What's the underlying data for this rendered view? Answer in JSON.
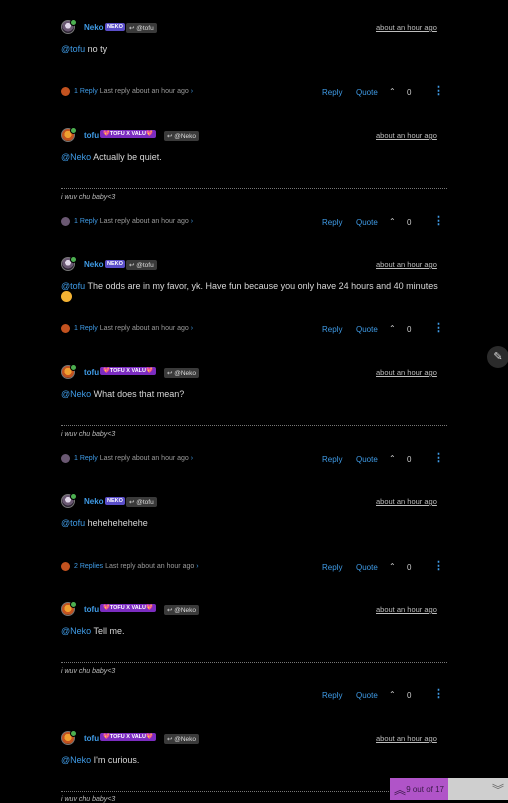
{
  "posts": [
    {
      "author": "Neko",
      "badge": "NEKO",
      "reply_to": "@tofu",
      "time": "about an hour ago",
      "mention": "@tofu",
      "text": " no ty",
      "replies": "1 Reply",
      "last_reply": "Last reply about an hour ago",
      "votes": "0"
    },
    {
      "author": "tofu",
      "badge": "💖TOFU X VALU💖",
      "reply_to": "@Neko",
      "time": "about an hour ago",
      "mention": "@Neko",
      "text": " Actually be quiet.",
      "signature": "i wuv chu baby<3",
      "replies": "1 Reply",
      "last_reply": "Last reply about an hour ago",
      "votes": "0"
    },
    {
      "author": "Neko",
      "badge": "NEKO",
      "reply_to": "@tofu",
      "time": "about an hour ago",
      "mention": "@tofu",
      "text": " The odds are in my favor, yk. Have fun because you only have 24 hours and 40 minutes",
      "replies": "1 Reply",
      "last_reply": "Last reply about an hour ago",
      "votes": "0"
    },
    {
      "author": "tofu",
      "badge": "💖TOFU X VALU💖",
      "reply_to": "@Neko",
      "time": "about an hour ago",
      "mention": "@Neko",
      "text": " What does that mean?",
      "signature": "i wuv chu baby<3",
      "replies": "1 Reply",
      "last_reply": "Last reply about an hour ago",
      "votes": "0"
    },
    {
      "author": "Neko",
      "badge": "NEKO",
      "reply_to": "@tofu",
      "time": "about an hour ago",
      "mention": "@tofu",
      "text": " hehehehehehe",
      "replies": "2 Replies",
      "last_reply": "Last reply about an hour ago",
      "votes": "0"
    },
    {
      "author": "tofu",
      "badge": "💖TOFU X VALU💖",
      "reply_to": "@Neko",
      "time": "about an hour ago",
      "mention": "@Neko",
      "text": " Tell me.",
      "signature": "i wuv chu baby<3",
      "votes": "0"
    },
    {
      "author": "tofu",
      "badge": "💖TOFU X VALU💖",
      "reply_to": "@Neko",
      "time": "about an hour ago",
      "mention": "@Neko",
      "text": " I'm curious.",
      "signature": "i wuv chu baby<3"
    }
  ],
  "labels": {
    "reply": "Reply",
    "quote": "Quote"
  },
  "pagination": "9 out of 17",
  "colors": {
    "link": "#3f9be6",
    "pager_active": "#b054c8"
  }
}
